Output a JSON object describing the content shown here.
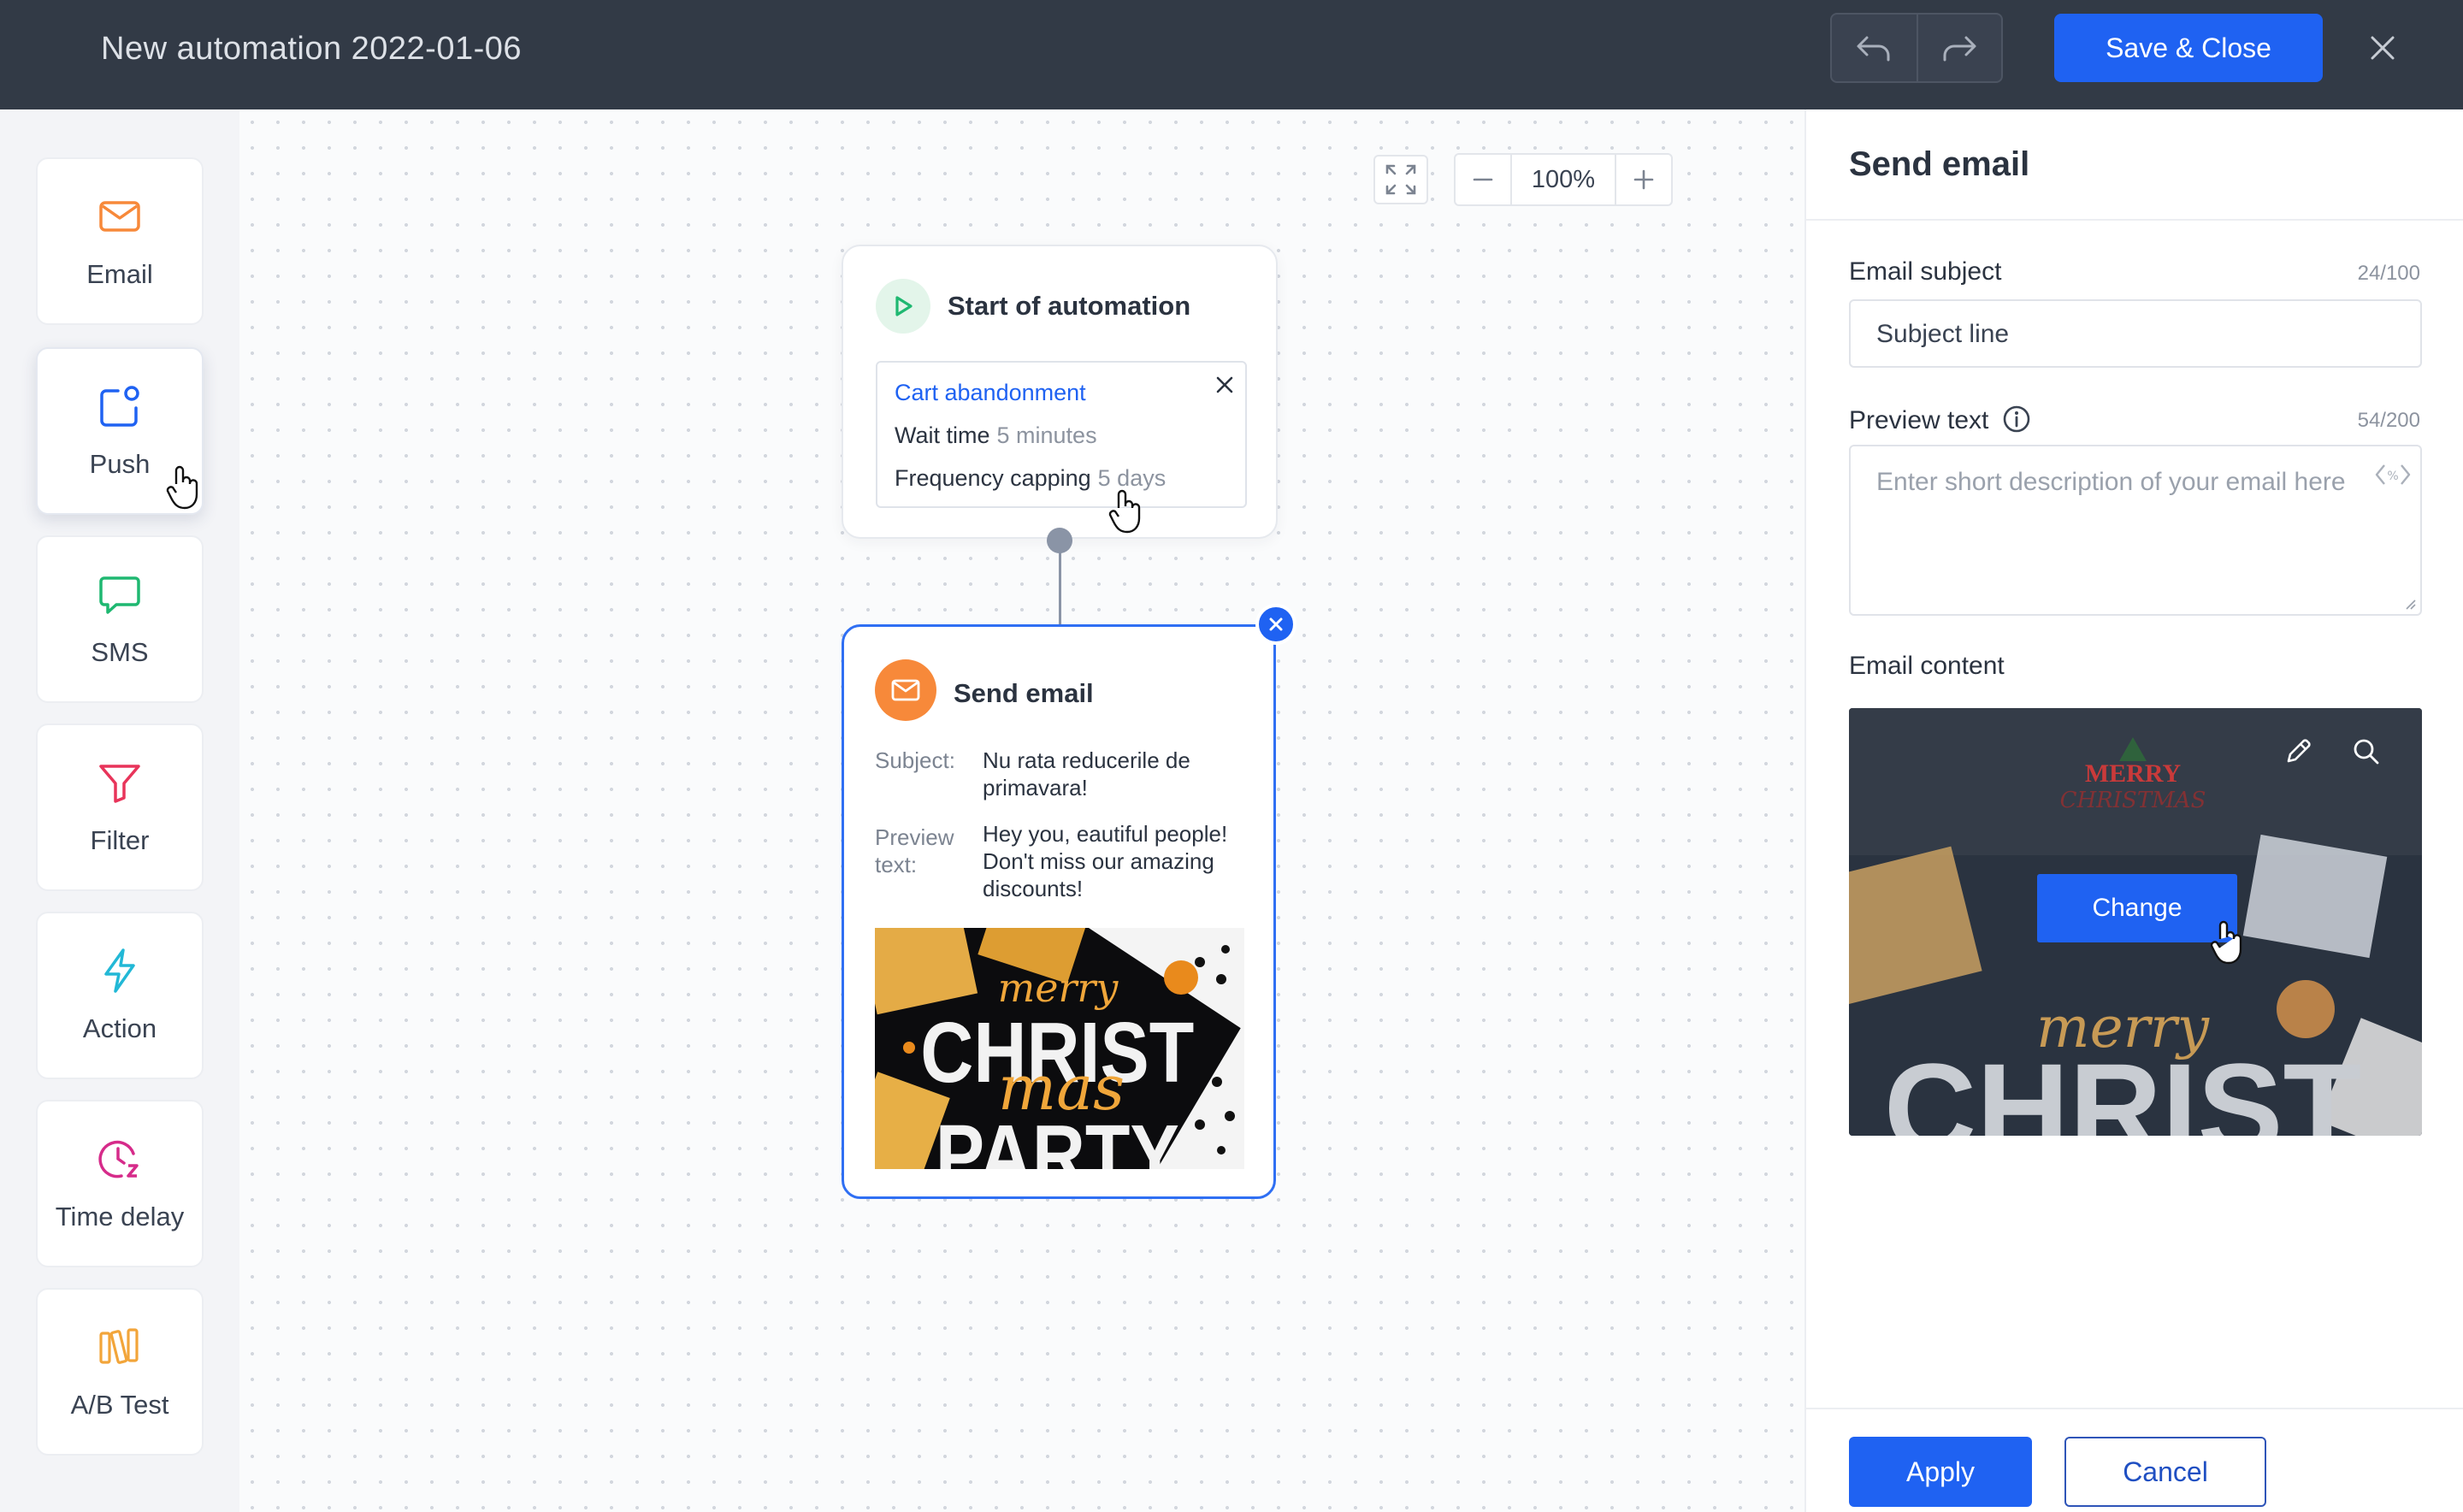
{
  "header": {
    "title": "New automation 2022-01-06",
    "save_label": "Save & Close"
  },
  "sidebar": {
    "tools": [
      {
        "label": "Email",
        "icon": "mail-icon",
        "color": "#f7893a"
      },
      {
        "label": "Push",
        "icon": "push-icon",
        "color": "#1f62f2"
      },
      {
        "label": "SMS",
        "icon": "chat-icon",
        "color": "#1fb871"
      },
      {
        "label": "Filter",
        "icon": "funnel-icon",
        "color": "#e8345a"
      },
      {
        "label": "Action",
        "icon": "bolt-icon",
        "color": "#22b8d6"
      },
      {
        "label": "Time delay",
        "icon": "clock-icon",
        "color": "#d62b8a"
      },
      {
        "label": "A/B Test",
        "icon": "ab-test-icon",
        "color": "#f2a53a"
      }
    ]
  },
  "canvas": {
    "zoom": "100%",
    "start_node": {
      "title": "Start of automation",
      "trigger": "Cart abandonment",
      "wait_label": "Wait time",
      "wait_value": "5 minutes",
      "freq_label": "Frequency capping",
      "freq_value": "5 days"
    },
    "email_node": {
      "title": "Send email",
      "subject_label": "Subject:",
      "subject_value": "Nu rata reducerile de primavara!",
      "preview_label": "Preview text:",
      "preview_value": "Hey you, eautiful people! Don't miss our amazing discounts!",
      "image_text": {
        "line1": "merry",
        "line2": "CHRIST",
        "line3": "mas",
        "line4": "PARTY"
      }
    }
  },
  "panel": {
    "title": "Send email",
    "subject_label": "Email subject",
    "subject_counter": "24/100",
    "subject_value": "Subject line",
    "preview_label": "Preview text",
    "preview_counter": "54/200",
    "preview_placeholder": "Enter short description of your email here",
    "content_label": "Email content",
    "content_preview": {
      "brand_top": "MERRY",
      "brand_bottom": "CHRISTMAS",
      "script": "merry",
      "big": "CHRIST"
    },
    "change_label": "Change",
    "apply_label": "Apply",
    "cancel_label": "Cancel"
  },
  "colors": {
    "accent": "#1f62f2",
    "topbar": "#323a46"
  }
}
